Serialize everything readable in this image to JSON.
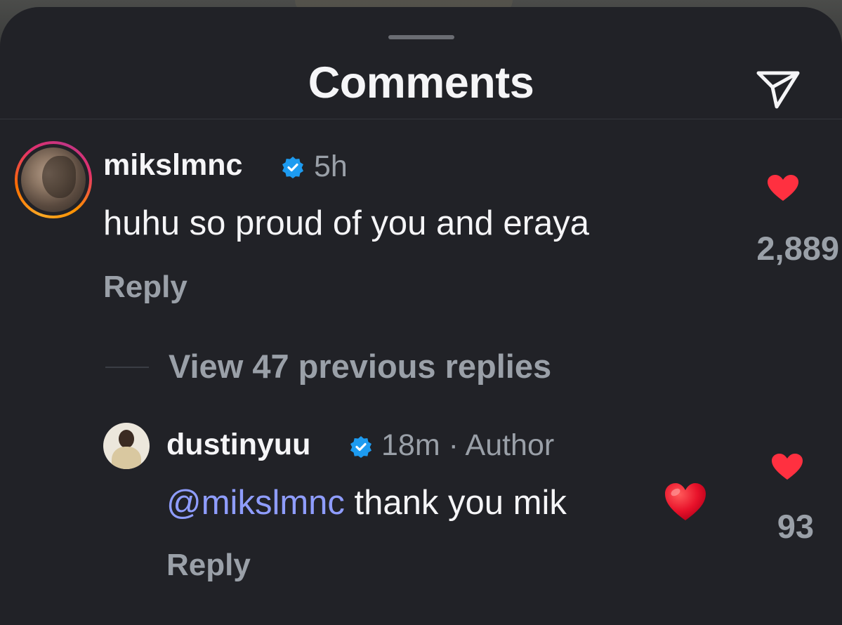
{
  "header": {
    "title": "Comments"
  },
  "icons": {
    "share": "paper-plane-icon",
    "verified": "verified-badge-icon",
    "like": "heart-icon",
    "emoji": "red-heart-emoji"
  },
  "colors": {
    "background": "#212227",
    "verified": "#1d9bf0",
    "like": "#ff3040",
    "mention": "#8f9dff",
    "secondary_text": "#9aa0a8"
  },
  "comments": [
    {
      "username": "mikslmnc",
      "verified": true,
      "time": "5h",
      "text": "huhu so proud of you and eraya",
      "reply_label": "Reply",
      "likes": "2,889"
    }
  ],
  "thread": {
    "view_replies_label": "View 47 previous replies"
  },
  "replies": [
    {
      "username": "dustinyuu",
      "verified": true,
      "time": "18m",
      "separator": "·",
      "role": "Author",
      "mention": "@mikslmnc",
      "text": "thank you mik",
      "emoji": "❤️",
      "reply_label": "Reply",
      "likes": "93"
    }
  ]
}
